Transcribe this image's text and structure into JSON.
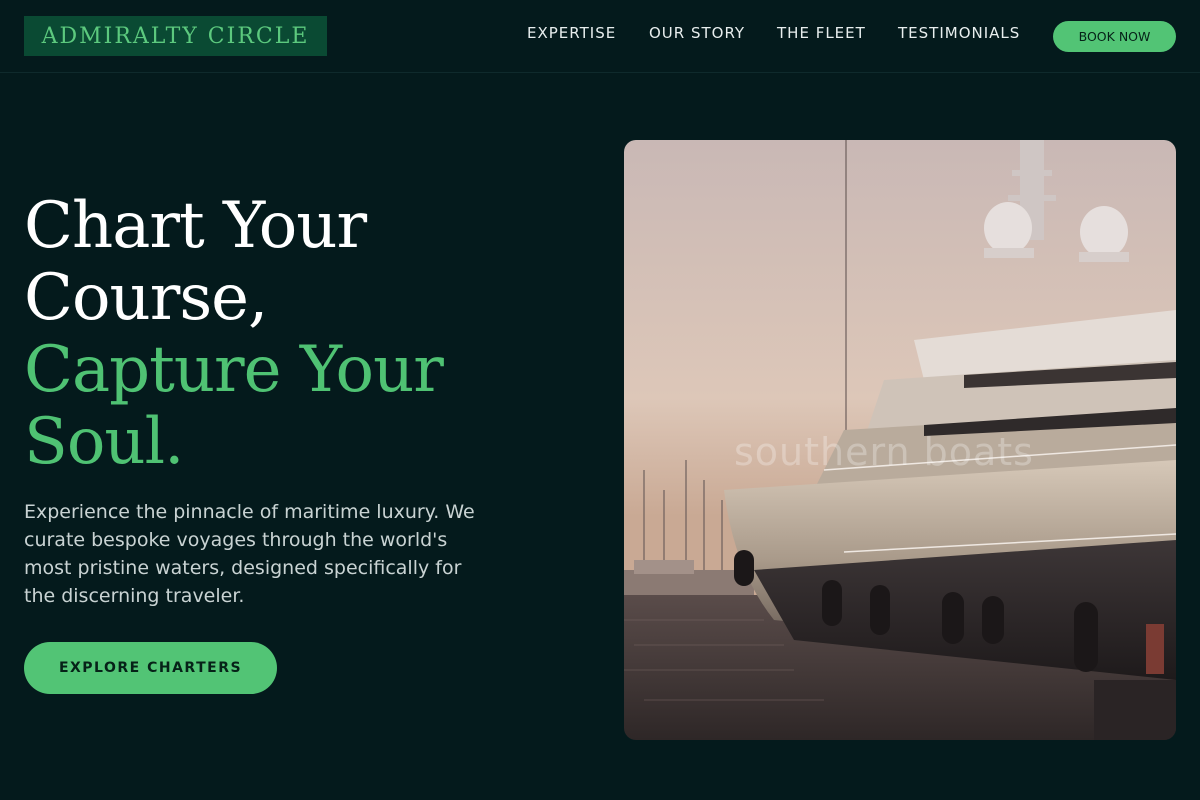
{
  "header": {
    "logo_text": "ADMIRALTY CIRCLE",
    "nav": [
      "EXPERTISE",
      "OUR STORY",
      "THE FLEET",
      "TESTIMONIALS"
    ],
    "book_label": "BOOK NOW"
  },
  "hero": {
    "title_line1": "Chart Your",
    "title_line2": "Course,",
    "title_line3": "Capture Your",
    "title_line4": "Soul.",
    "description": "Experience the pinnacle of maritime luxury. We curate bespoke voyages through the world's most pristine waters, designed specifically for the discerning traveler.",
    "cta_label": "EXPLORE CHARTERS",
    "image_watermark": "southern boats"
  },
  "colors": {
    "background": "#041a1c",
    "accent": "#52c475",
    "logo_bg": "#0a4a33"
  }
}
